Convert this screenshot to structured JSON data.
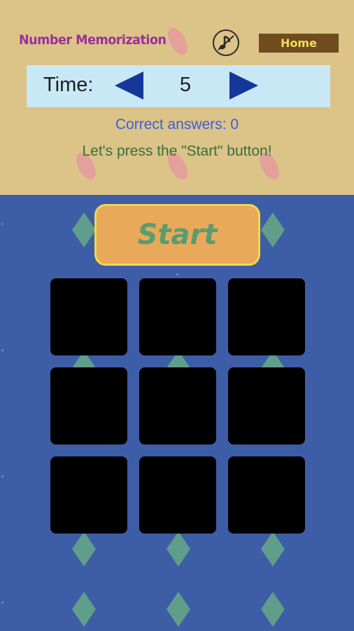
{
  "header": {
    "title": "Number Memorization",
    "music_icon": "music-off-icon",
    "home_label": "Home"
  },
  "time_control": {
    "label": "Time:",
    "value": "5",
    "decrease_icon": "triangle-left-icon",
    "increase_icon": "triangle-right-icon"
  },
  "status": {
    "correct_answers": "Correct answers: 0",
    "message": "Let's press the \"Start\" button!"
  },
  "start_label": "Start",
  "cards": [
    {
      "label": "card-1"
    },
    {
      "label": "card-2"
    },
    {
      "label": "card-3"
    },
    {
      "label": "card-4"
    },
    {
      "label": "card-5"
    },
    {
      "label": "card-6"
    },
    {
      "label": "card-7"
    },
    {
      "label": "card-8"
    },
    {
      "label": "card-9"
    }
  ],
  "colors": {
    "top_background": "#dcc388",
    "bottom_background": "#3d5da6",
    "title": "#9b2fa0",
    "home_button": "#6e4c1d",
    "home_text": "#f3dd5e",
    "time_bar": "#c9e8f6",
    "arrow": "#15379a",
    "correct_text": "#3d5de0",
    "message_text": "#3c6e3a",
    "start_button": "#e8a95a",
    "start_text": "#5a9b72",
    "card": "#000000"
  }
}
